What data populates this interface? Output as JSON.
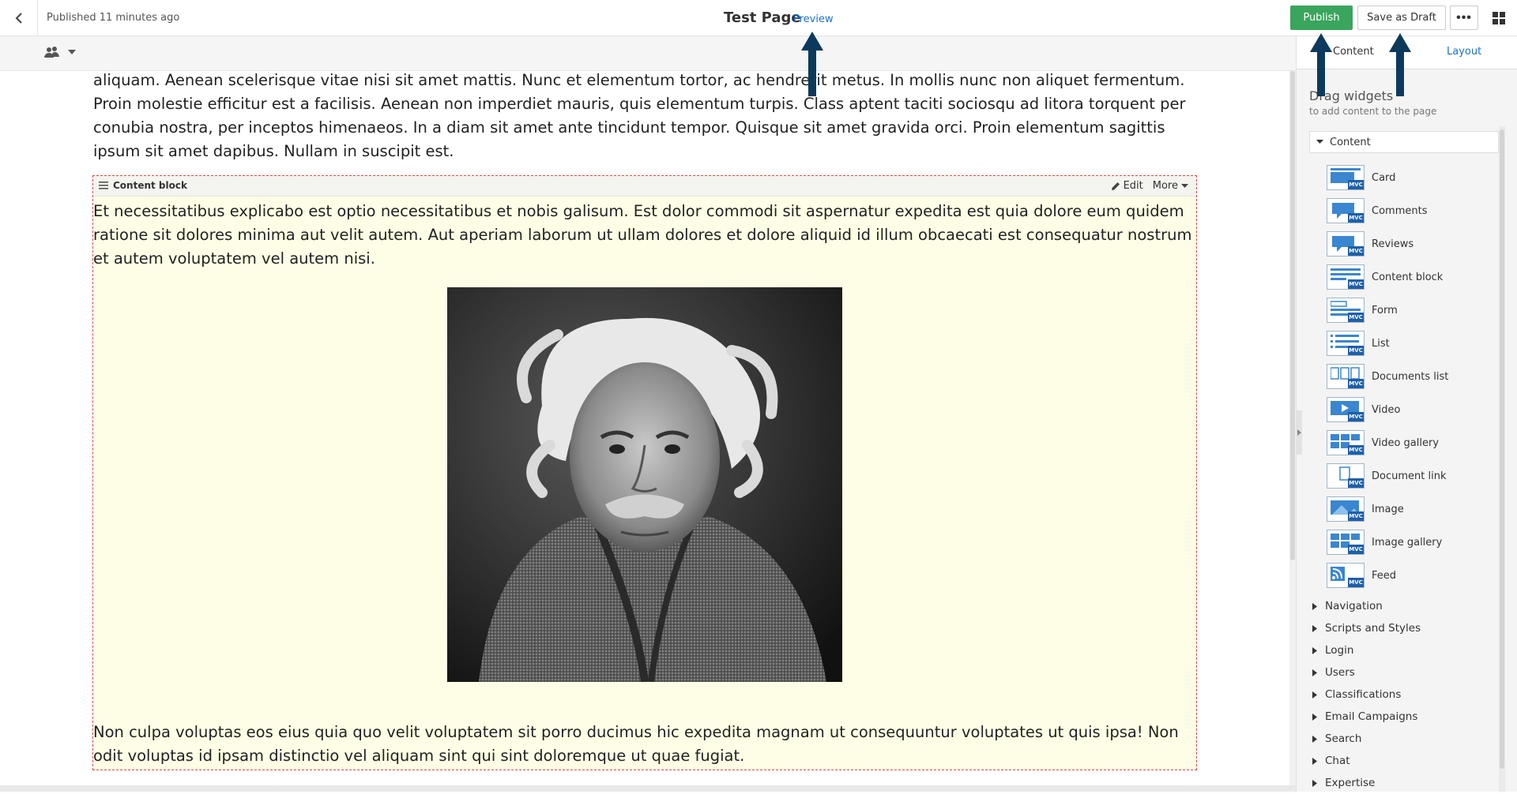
{
  "topbar": {
    "status": "Published 11 minutes ago",
    "title": "Test Page",
    "preview": "Preview",
    "publish": "Publish",
    "save_draft": "Save as Draft"
  },
  "panel": {
    "tabs": {
      "content": "Content",
      "layout": "Layout"
    },
    "drag_title": "Drag widgets",
    "drag_subtitle": "to add content to the page",
    "section": "Content",
    "widgets": [
      {
        "label": "Card",
        "icon": "card-widget-icon"
      },
      {
        "label": "Comments",
        "icon": "comments-widget-icon"
      },
      {
        "label": "Reviews",
        "icon": "reviews-widget-icon"
      },
      {
        "label": "Content block",
        "icon": "content-block-widget-icon"
      },
      {
        "label": "Form",
        "icon": "form-widget-icon"
      },
      {
        "label": "List",
        "icon": "list-widget-icon"
      },
      {
        "label": "Documents list",
        "icon": "documents-list-widget-icon"
      },
      {
        "label": "Video",
        "icon": "video-widget-icon"
      },
      {
        "label": "Video gallery",
        "icon": "video-gallery-widget-icon"
      },
      {
        "label": "Document link",
        "icon": "document-link-widget-icon"
      },
      {
        "label": "Image",
        "icon": "image-widget-icon"
      },
      {
        "label": "Image gallery",
        "icon": "image-gallery-widget-icon"
      },
      {
        "label": "Feed",
        "icon": "feed-widget-icon"
      }
    ],
    "mvc_badge": "MVC",
    "categories": [
      "Navigation",
      "Scripts and Styles",
      "Login",
      "Users",
      "Classifications",
      "Email Campaigns",
      "Search",
      "Chat",
      "Expertise"
    ]
  },
  "canvas": {
    "intro": "aliquam. Aenean scelerisque vitae nisi sit amet mattis. Nunc et elementum tortor, ac hendrerit metus. In mollis nunc non aliquet fermentum. Proin molestie efficitur est a facilisis. Aenean non imperdiet mauris, quis elementum turpis. Class aptent taciti sociosqu ad litora torquent per conubia nostra, per inceptos himenaeos. In a diam sit amet ante tincidunt tempor. Quisque sit amet gravida orci. Proin elementum sagittis ipsum sit amet dapibus. Nullam in suscipit est.",
    "block": {
      "label": "Content block",
      "edit": "Edit",
      "more": "More",
      "paragraph1": "Et necessitatibus explicabo est optio necessitatibus et nobis galisum. Est dolor commodi sit aspernatur expedita est quia dolore eum quidem ratione sit dolores minima aut velit autem. Aut aperiam laborum ut ullam dolores et dolore aliquid id illum obcaecati est consequatur nostrum et autem voluptatem vel autem nisi.",
      "paragraph2": "Non culpa voluptas eos eius quia quo velit voluptatem sit porro ducimus hic expedita magnam ut consequuntur voluptates ut quis ipsa! Non odit voluptas id ipsam distinctio vel aliquam sint qui sint doloremque ut quae fugiat."
    }
  },
  "colors": {
    "publish": "#3aa55c",
    "link": "#1a73c8",
    "block_border": "#e34848",
    "block_bg": "#fefee6",
    "arrow": "#0d3a5c",
    "mvc_badge": "#1f5fa8"
  }
}
